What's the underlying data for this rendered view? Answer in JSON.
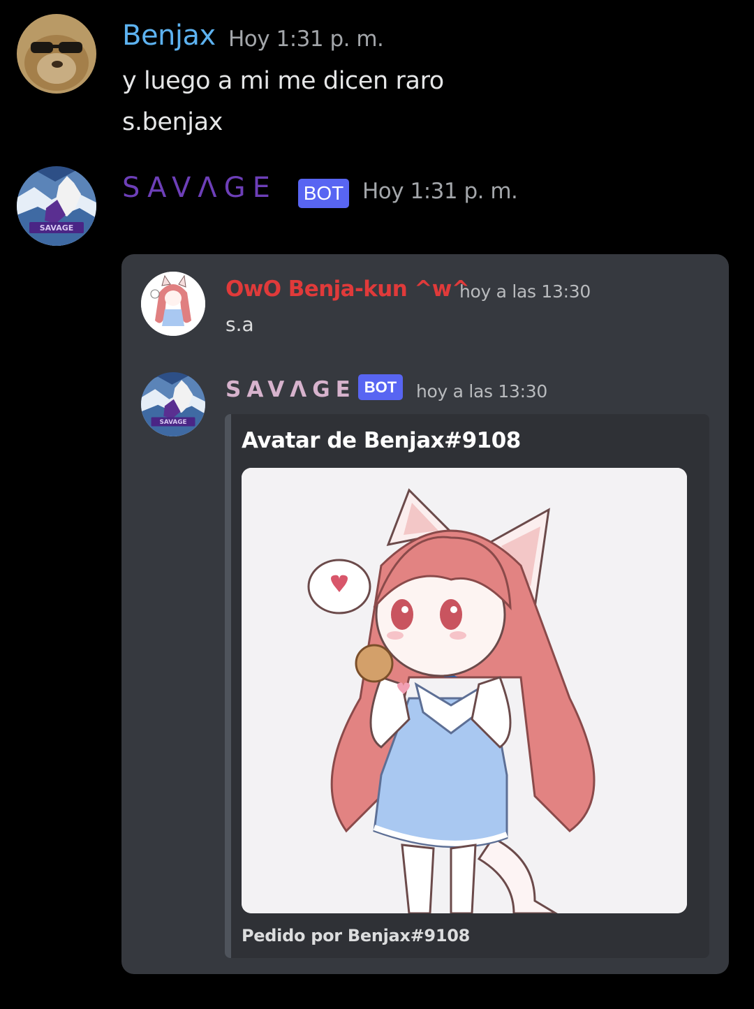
{
  "messages": [
    {
      "author": "Benjax",
      "author_color": "#5db2f0",
      "timestamp": "Hoy 1:31 p. m.",
      "avatar_icon": "dog-with-sunglasses-avatar",
      "lines": [
        "y luego a mi me dicen raro",
        "s.benjax"
      ]
    },
    {
      "author": "SAVΛGE",
      "author_color": "#6d3fb8",
      "bot_tag": "BOT",
      "timestamp": "Hoy 1:31 p. m.",
      "avatar_icon": "howling-wolf-avatar",
      "avatar_logo_text": "SAVAGE",
      "quoted": {
        "messages": [
          {
            "author": "OwO Benja-kun ^w^",
            "author_color": "#e03a3a",
            "timestamp": "hoy a las 13:30",
            "avatar_icon": "anime-cat-girl-avatar",
            "text": "s.a"
          },
          {
            "author": "SAVΛGE",
            "author_color": "#d7b3cd",
            "bot_tag": "BOT",
            "timestamp": "hoy a las 13:30",
            "avatar_icon": "howling-wolf-avatar",
            "embed": {
              "title": "Avatar de Benjax#9108",
              "image_icon": "anime-cat-girl-illustration",
              "footer": "Pedido por Benjax#9108"
            }
          }
        ]
      }
    }
  ],
  "colors": {
    "background": "#000000",
    "panel": "#36393f",
    "embed": "#2f3136",
    "bot_tag": "#5865f2",
    "timestamp": "#a3a6aa"
  }
}
